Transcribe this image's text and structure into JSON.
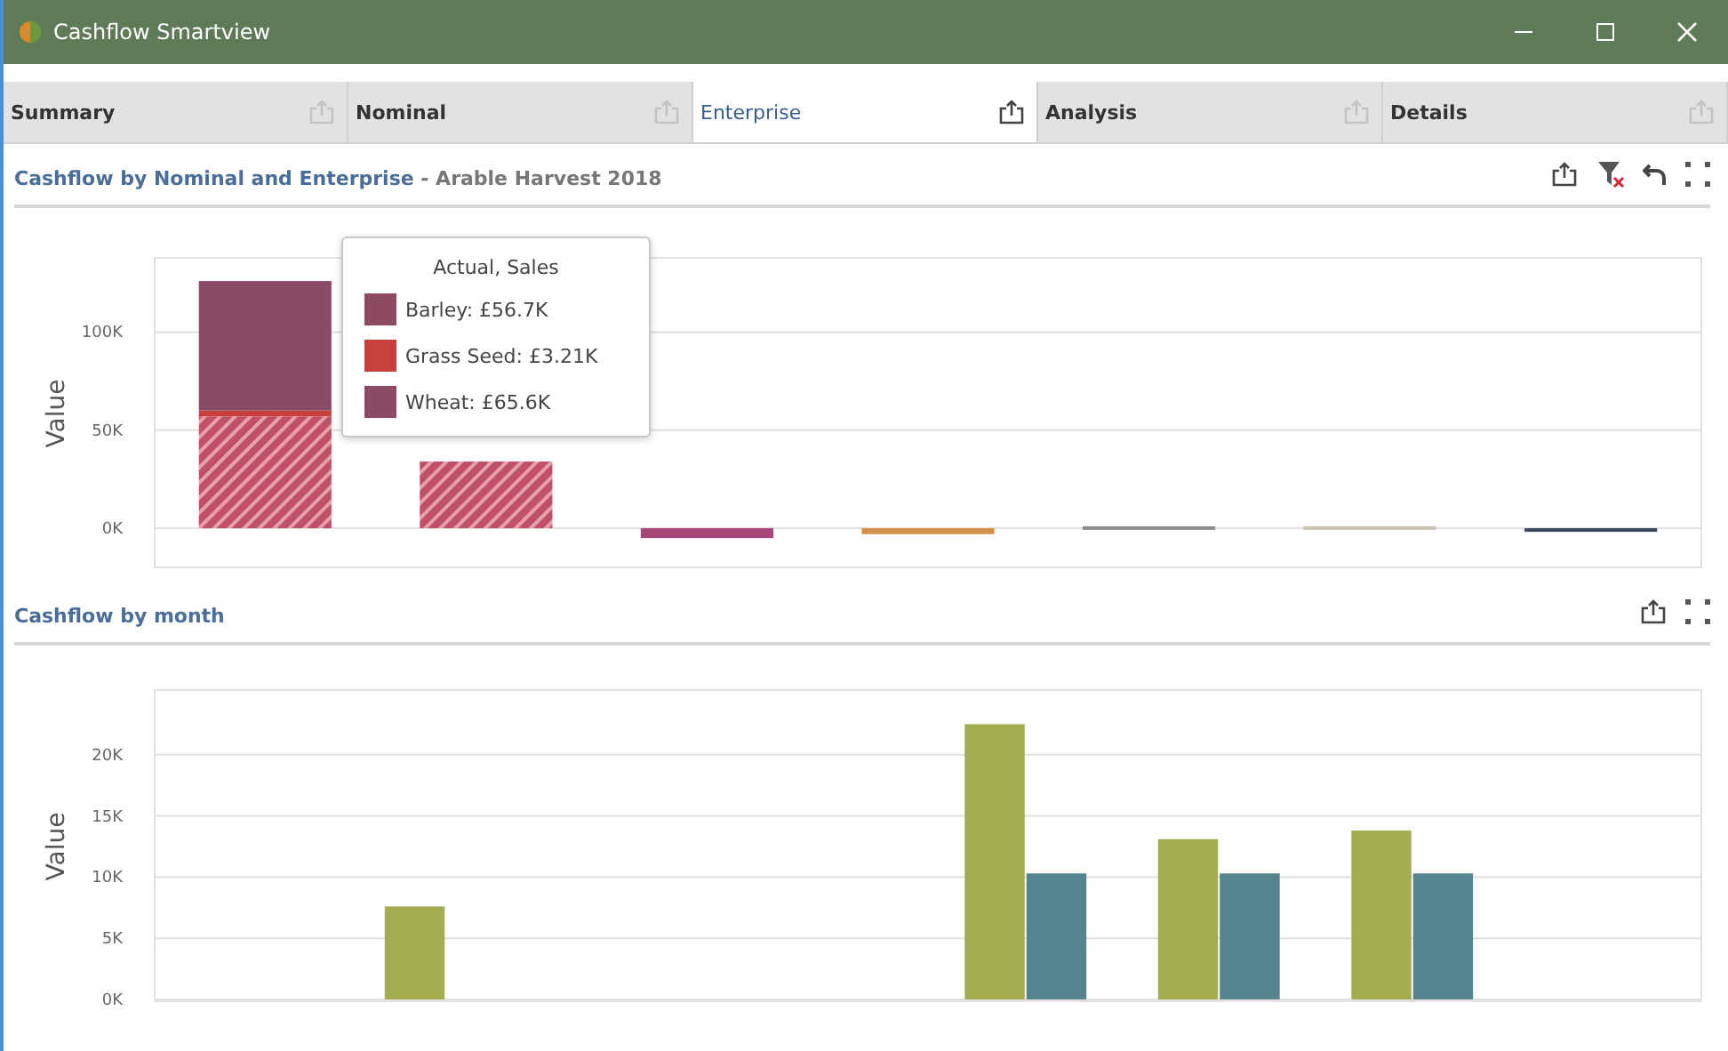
{
  "window": {
    "title": "Cashflow Smartview"
  },
  "tabs": [
    {
      "label": "Summary",
      "selected": false
    },
    {
      "label": "Nominal",
      "selected": false
    },
    {
      "label": "Enterprise",
      "selected": true
    },
    {
      "label": "Analysis",
      "selected": false
    },
    {
      "label": "Details",
      "selected": false
    }
  ],
  "panels": [
    {
      "title": "Cashflow by Nominal and Enterprise",
      "subtitle": " - Arable Harvest 2018",
      "tools": [
        {
          "kind": "export"
        },
        {
          "kind": "clear-filter"
        },
        {
          "kind": "undo"
        },
        {
          "kind": "fullscreen"
        }
      ],
      "series_fill": [
        {
          "hatched": true
        },
        {
          "hatched": false
        },
        {
          "hatched": false
        },
        {
          "hatched": false
        },
        {
          "hatched": false
        },
        {
          "hatched": false
        },
        {
          "hatched": false
        },
        {
          "hatched": false
        }
      ],
      "tooltip": {
        "title": "Actual, Sales",
        "items": [
          {
            "label": "Barley: £56.7K",
            "color": "#8e4a62"
          },
          {
            "label": "Grass Seed: £3.21K",
            "color": "#c8403c"
          },
          {
            "label": "Wheat: £65.6K",
            "color": "#8b4a66"
          }
        ]
      },
      "chart_data": {
        "type": "bar",
        "stacked": true,
        "grid": true,
        "ylabel": "Value",
        "ylim": [
          -19000,
          136000
        ],
        "yticks": [
          {
            "value": 0,
            "label": "0K"
          },
          {
            "value": 50000,
            "label": "50K"
          },
          {
            "value": 100000,
            "label": "100K"
          }
        ],
        "series": [
          {
            "color": "#c0506a",
            "values": [
              57000,
              34000,
              null,
              null,
              null,
              null,
              null
            ]
          },
          {
            "color": "#c8403c",
            "values": [
              3000,
              null,
              null,
              null,
              null,
              null,
              null
            ]
          },
          {
            "color": "#8b4a66",
            "values": [
              66000,
              null,
              null,
              null,
              null,
              null,
              null
            ]
          },
          {
            "color": "#a8457a",
            "values": [
              null,
              null,
              -5000,
              null,
              null,
              null,
              null
            ]
          },
          {
            "color": "#d4914a",
            "values": [
              null,
              null,
              null,
              -3000,
              null,
              null,
              null
            ]
          },
          {
            "color": "#8c8c8c",
            "values": [
              null,
              null,
              null,
              null,
              1000,
              null,
              null
            ]
          },
          {
            "color": "#c9c4b0",
            "values": [
              null,
              null,
              null,
              null,
              null,
              1000,
              null
            ]
          },
          {
            "color": "#3c4660",
            "values": [
              null,
              null,
              null,
              null,
              null,
              null,
              -1000
            ]
          }
        ]
      }
    },
    {
      "title": "Cashflow by month",
      "tools": [
        {
          "kind": "export"
        },
        {
          "kind": "fullscreen"
        }
      ],
      "chart_data": {
        "type": "bar",
        "grid": true,
        "ylabel": "Value",
        "ylim": [
          0,
          25000
        ],
        "yticks": [
          {
            "value": 0,
            "label": "0K"
          },
          {
            "value": 5000,
            "label": "5K"
          },
          {
            "value": 10000,
            "label": "10K"
          },
          {
            "value": 15000,
            "label": "15K"
          },
          {
            "value": 20000,
            "label": "20K"
          }
        ],
        "series": [
          {
            "color": "#a3ac4e",
            "values": [
              null,
              7600,
              null,
              null,
              22500,
              13100,
              13800,
              null
            ]
          },
          {
            "color": "#55848f",
            "values": [
              null,
              null,
              null,
              null,
              10300,
              10300,
              10300,
              null
            ]
          }
        ]
      }
    }
  ]
}
